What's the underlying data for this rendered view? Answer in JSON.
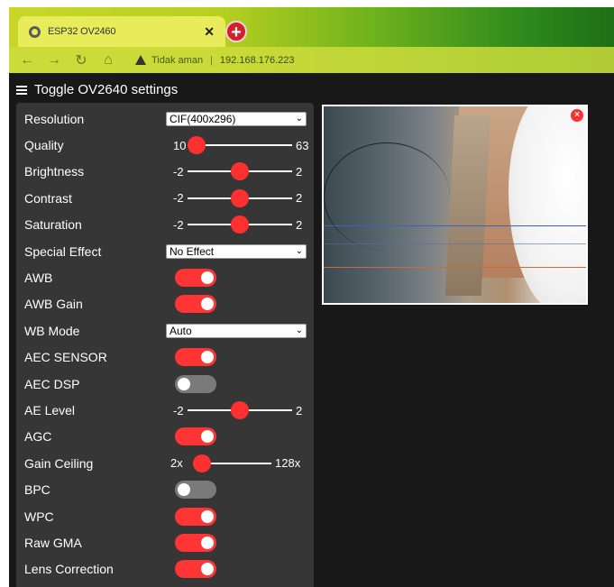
{
  "browser": {
    "tab_title": "ESP32 OV2460",
    "tab_close": "✕",
    "new_tab": "+",
    "security_label": "Tidak aman",
    "separator": "|",
    "url": "192.168.176.223"
  },
  "page": {
    "menu_toggle_label": "Toggle OV2640 settings",
    "settings": [
      {
        "type": "select",
        "label": "Resolution",
        "value": "CIF(400x296)"
      },
      {
        "type": "slider",
        "label": "Quality",
        "min": "10",
        "max": "63",
        "position": 0.0
      },
      {
        "type": "slider",
        "label": "Brightness",
        "min": "-2",
        "max": "2",
        "position": 0.5
      },
      {
        "type": "slider",
        "label": "Contrast",
        "min": "-2",
        "max": "2",
        "position": 0.5
      },
      {
        "type": "slider",
        "label": "Saturation",
        "min": "-2",
        "max": "2",
        "position": 0.5
      },
      {
        "type": "select",
        "label": "Special Effect",
        "value": "No Effect"
      },
      {
        "type": "toggle",
        "label": "AWB",
        "on": true
      },
      {
        "type": "toggle",
        "label": "AWB Gain",
        "on": true
      },
      {
        "type": "select",
        "label": "WB Mode",
        "value": "Auto"
      },
      {
        "type": "toggle",
        "label": "AEC SENSOR",
        "on": true
      },
      {
        "type": "toggle",
        "label": "AEC DSP",
        "on": false
      },
      {
        "type": "slider",
        "label": "AE Level",
        "min": "-2",
        "max": "2",
        "position": 0.5
      },
      {
        "type": "toggle",
        "label": "AGC",
        "on": true
      },
      {
        "type": "slider",
        "label": "Gain Ceiling",
        "min": "2x",
        "max": "128x",
        "position": 0.0
      },
      {
        "type": "toggle",
        "label": "BPC",
        "on": false
      },
      {
        "type": "toggle",
        "label": "WPC",
        "on": true
      },
      {
        "type": "toggle",
        "label": "Raw GMA",
        "on": true
      },
      {
        "type": "toggle",
        "label": "Lens Correction",
        "on": true
      }
    ]
  },
  "stream": {
    "close_symbol": "×"
  },
  "colors": {
    "accent": "#ff3434",
    "panel": "#363636",
    "page_bg": "#181818"
  }
}
